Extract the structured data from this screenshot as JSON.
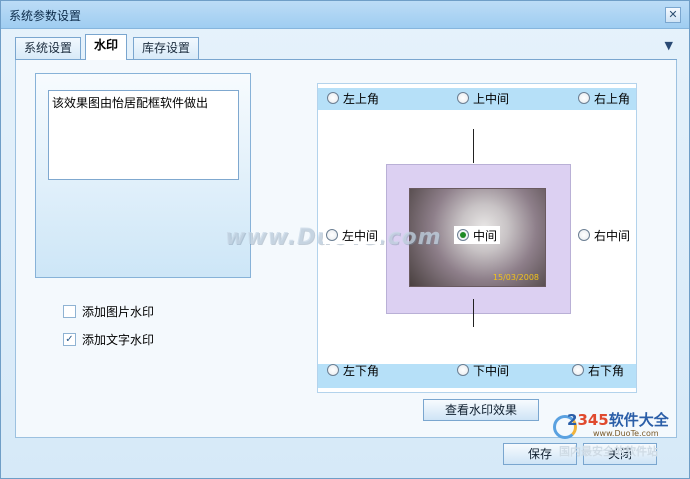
{
  "window": {
    "title": "系统参数设置",
    "close_glyph": "✕"
  },
  "tabs": [
    {
      "label": "系统设置",
      "active": false
    },
    {
      "label": "水印",
      "active": true
    },
    {
      "label": "库存设置",
      "active": false
    }
  ],
  "tab_menu_glyph": "▼",
  "watermark": {
    "text_value": "该效果图由怡居配框软件做出",
    "options": [
      {
        "label": "添加图片水印",
        "checked": false
      },
      {
        "label": "添加文字水印",
        "checked": true
      }
    ],
    "checkmark": "✓"
  },
  "positions": {
    "top_left": "左上角",
    "top_center": "上中间",
    "top_right": "右上角",
    "middle_left": "左中间",
    "center": "中间",
    "middle_right": "右中间",
    "bottom_left": "左下角",
    "bottom_center": "下中间",
    "bottom_right": "右下角",
    "selected": "center"
  },
  "preview": {
    "photo_date": "15/03/2008",
    "ghost_watermark": "www.DuoTe.com"
  },
  "buttons": {
    "view_effect": "查看水印效果",
    "save": "保存",
    "close": "关闭"
  },
  "branding": {
    "logo_prefix": "2",
    "logo_num": "345",
    "logo_suffix": "软件大全",
    "url": "www.DuoTe.com",
    "slogan": "国内最安全的软件站"
  },
  "colors": {
    "accent": "#7aa6cf",
    "band": "#b6e0f8",
    "photo_frame": "#dcd0f2",
    "radio_selected": "#1f8a25"
  }
}
